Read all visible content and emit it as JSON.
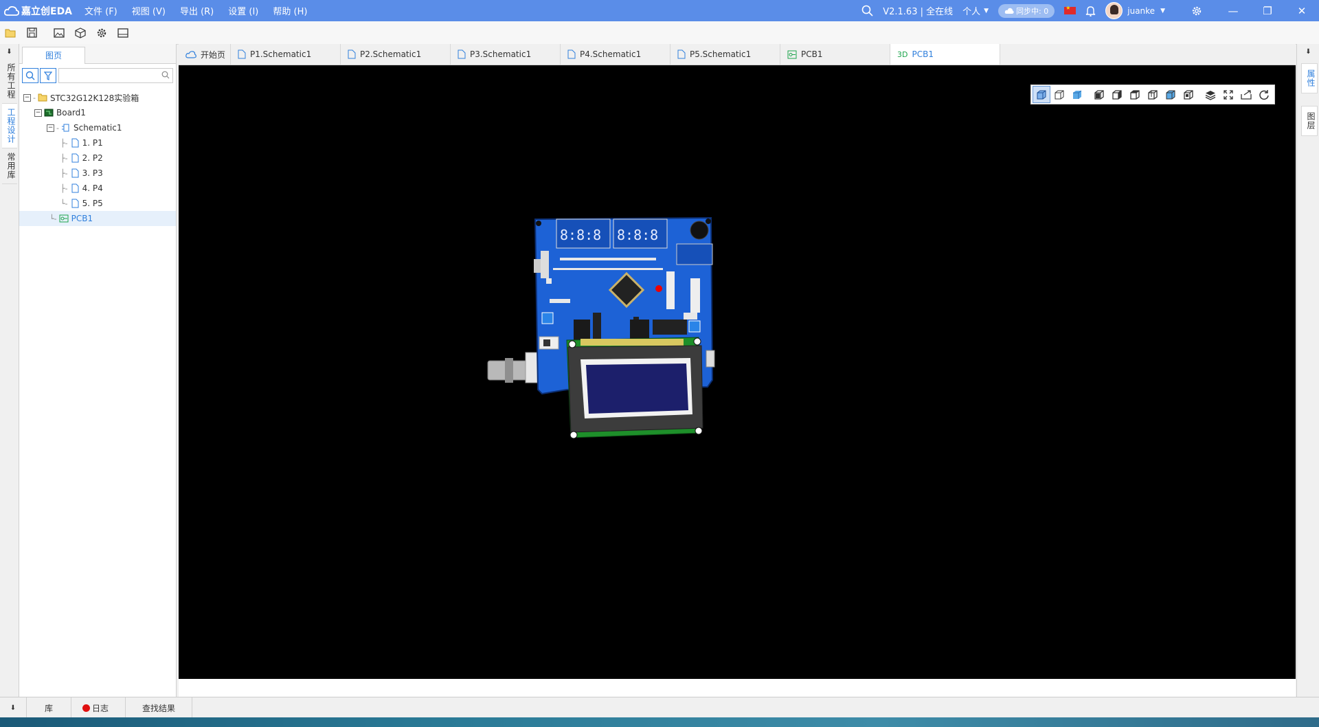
{
  "app": {
    "logo_text": "嘉立创EDA",
    "menu": [
      "文件 (F)",
      "视图 (V)",
      "导出 (R)",
      "设置 (I)",
      "帮助 (H)"
    ],
    "version_status": "V2.1.63 | 全在线",
    "workspace": "个人",
    "sync_label": "同步中: 0",
    "username": "juanke"
  },
  "toolbar_icons": [
    "folder-icon",
    "save-icon",
    "image-icon",
    "package-icon",
    "gear-icon",
    "panel-icon"
  ],
  "left_strip": {
    "tabs": [
      "所有工程",
      "工程设计",
      "常用库"
    ]
  },
  "left_panel": {
    "tab": "图页",
    "search_placeholder": "",
    "tree": {
      "project": "STC32G12K128实验箱",
      "board": "Board1",
      "schematic": "Schematic1",
      "pages": [
        "1. P1",
        "2. P2",
        "3. P3",
        "4. P4",
        "5. P5"
      ],
      "pcb": "PCB1"
    }
  },
  "editor_tabs": [
    {
      "label": "开始页",
      "icon": "cloud-icon"
    },
    {
      "label": "P1.Schematic1",
      "icon": "page-icon"
    },
    {
      "label": "P2.Schematic1",
      "icon": "page-icon"
    },
    {
      "label": "P3.Schematic1",
      "icon": "page-icon"
    },
    {
      "label": "P4.Schematic1",
      "icon": "page-icon"
    },
    {
      "label": "P5.Schematic1",
      "icon": "page-icon"
    },
    {
      "label": "PCB1",
      "icon": "pcb-icon"
    },
    {
      "label": "PCB1",
      "icon": "3d-icon",
      "prefix": "3D"
    }
  ],
  "right_strip": {
    "tabs": [
      "属性",
      "图层"
    ]
  },
  "bottom_tabs": [
    "库",
    "日志",
    "查找结果"
  ],
  "colors": {
    "titlebar": "#5a8de8",
    "accent": "#2f7fdc",
    "pcb_blue": "#1d62d6",
    "lcd_blue": "#1c1f6b",
    "canvas": "#000000"
  }
}
